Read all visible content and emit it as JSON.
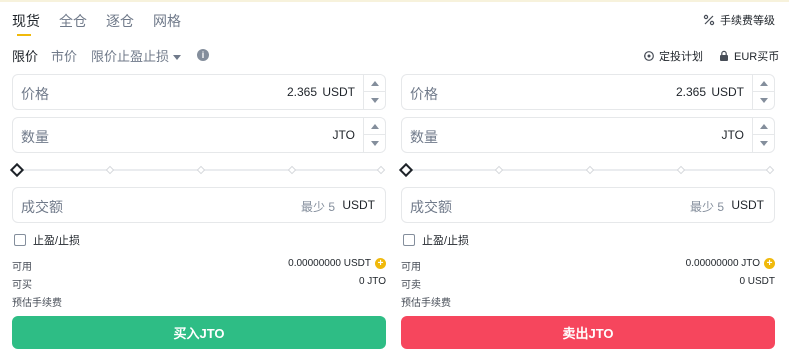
{
  "tabs": {
    "items": [
      {
        "label": "现货",
        "active": true
      },
      {
        "label": "全仓",
        "active": false
      },
      {
        "label": "逐仓",
        "active": false
      },
      {
        "label": "网格",
        "active": false
      }
    ],
    "fee_link": {
      "label": "手续费等级",
      "icon": "percent-icon"
    }
  },
  "order_types": {
    "items": [
      {
        "label": "限价",
        "active": true
      },
      {
        "label": "市价",
        "active": false
      },
      {
        "label": "限价止盈止损",
        "active": false,
        "dropdown": true
      }
    ],
    "info_icon": "info-icon",
    "links": [
      {
        "label": "定投计划",
        "icon": "recurring-icon"
      },
      {
        "label": "EUR买币",
        "icon": "lock-icon"
      }
    ]
  },
  "buy": {
    "price": {
      "label": "价格",
      "value": "2.365",
      "unit": "USDT"
    },
    "amount": {
      "label": "数量",
      "value": "",
      "unit": "JTO"
    },
    "slider_percent": 0,
    "total": {
      "label": "成交额",
      "placeholder": "最少 5",
      "unit": "USDT"
    },
    "tpsl_label": "止盈/止损",
    "available": {
      "label": "可用",
      "value": "0.00000000 USDT"
    },
    "can_trade": {
      "label": "可买",
      "value": "0 JTO"
    },
    "fee": {
      "label": "预估手续费",
      "value": ""
    },
    "button": "买入JTO"
  },
  "sell": {
    "price": {
      "label": "价格",
      "value": "2.365",
      "unit": "USDT"
    },
    "amount": {
      "label": "数量",
      "value": "",
      "unit": "JTO"
    },
    "slider_percent": 0,
    "total": {
      "label": "成交额",
      "placeholder": "最少 5",
      "unit": "USDT"
    },
    "tpsl_label": "止盈/止损",
    "available": {
      "label": "可用",
      "value": "0.00000000 JTO"
    },
    "can_trade": {
      "label": "可卖",
      "value": "0 USDT"
    },
    "fee": {
      "label": "预估手续费",
      "value": ""
    },
    "button": "卖出JTO"
  },
  "colors": {
    "accent": "#f0b90b",
    "buy": "#2ebd85",
    "sell": "#f6465d",
    "text": "#1e2329",
    "muted": "#707a8a"
  }
}
